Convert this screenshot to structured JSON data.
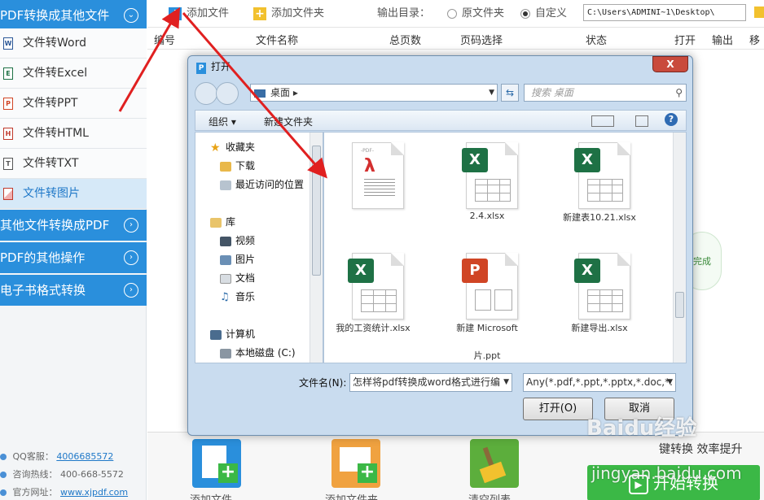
{
  "sidebar": {
    "header": "PDF转换成其他文件",
    "items": [
      {
        "label": "文件转Word",
        "icon_text": "W",
        "icon_color": "#2b5797"
      },
      {
        "label": "文件转Excel",
        "icon_text": "E",
        "icon_color": "#1e7145"
      },
      {
        "label": "文件转PPT",
        "icon_text": "P",
        "icon_color": "#d04525"
      },
      {
        "label": "文件转HTML",
        "icon_text": "H",
        "icon_color": "#c0392b"
      },
      {
        "label": "文件转TXT",
        "icon_text": "T",
        "icon_color": "#555555"
      },
      {
        "label": "文件转图片",
        "icon_text": "",
        "icon_color": "#c0392b"
      }
    ],
    "categories": [
      "其他文件转换成PDF",
      "PDF的其他操作",
      "电子书格式转换"
    ],
    "contact": {
      "qq_label": "QQ客服：",
      "qq_value": "4006685572",
      "hotline_label": "咨询热线：",
      "hotline_value": "400-668-5572",
      "site_label": "官方网址：",
      "site_value": "www.xjpdf.com"
    }
  },
  "toolbar": {
    "add_file": "添加文件",
    "add_folder": "添加文件夹",
    "output_label": "输出目录：",
    "radio_original": "原文件夹",
    "radio_custom": "自定义",
    "path_value": "C:\\Users\\ADMINI~1\\Desktop\\"
  },
  "table_headers": [
    "编号",
    "文件名称",
    "总页数",
    "页码选择",
    "状态",
    "打开",
    "输出",
    "移"
  ],
  "status_badge": "完成",
  "bottom": {
    "add_file": "添加文件",
    "add_folder": "添加文件夹",
    "clear_list": "清空列表",
    "hint": "键转换 效率提升",
    "start": "开始转换"
  },
  "watermark": {
    "line1": "Baidu经验",
    "line2": "jingyan.baidu.com"
  },
  "dialog": {
    "title": "打开",
    "close": "X",
    "address": "桌面",
    "search_placeholder": "搜索 桌面",
    "organize": "组织 ▾",
    "new_folder": "新建文件夹",
    "nav": {
      "favorites": "收藏夹",
      "downloads": "下载",
      "recent": "最近访问的位置",
      "libraries": "库",
      "videos": "视频",
      "pictures": "图片",
      "documents": "文档",
      "music": "音乐",
      "computer": "计算机",
      "local_disk": "本地磁盘 (C:)"
    },
    "files": [
      {
        "type": "pdf",
        "name": ""
      },
      {
        "type": "xlsx",
        "name": "2.4.xlsx"
      },
      {
        "type": "xlsx",
        "name": "新建表10.21.xlsx"
      },
      {
        "type": "xlsx",
        "name": "我的工资统计.xlsx"
      },
      {
        "type": "ppt",
        "name": "新建 Microsoft"
      },
      {
        "type": "xlsx",
        "name": "新建导出.xlsx"
      }
    ],
    "extra_name": "片.ppt",
    "filename_label": "文件名(N):",
    "filename_value": "怎样将pdf转换成word格式进行编",
    "filetype_value": "Any(*.pdf,*.ppt,*.pptx,*.doc,*.",
    "open_button": "打开(O)",
    "cancel_button": "取消"
  }
}
